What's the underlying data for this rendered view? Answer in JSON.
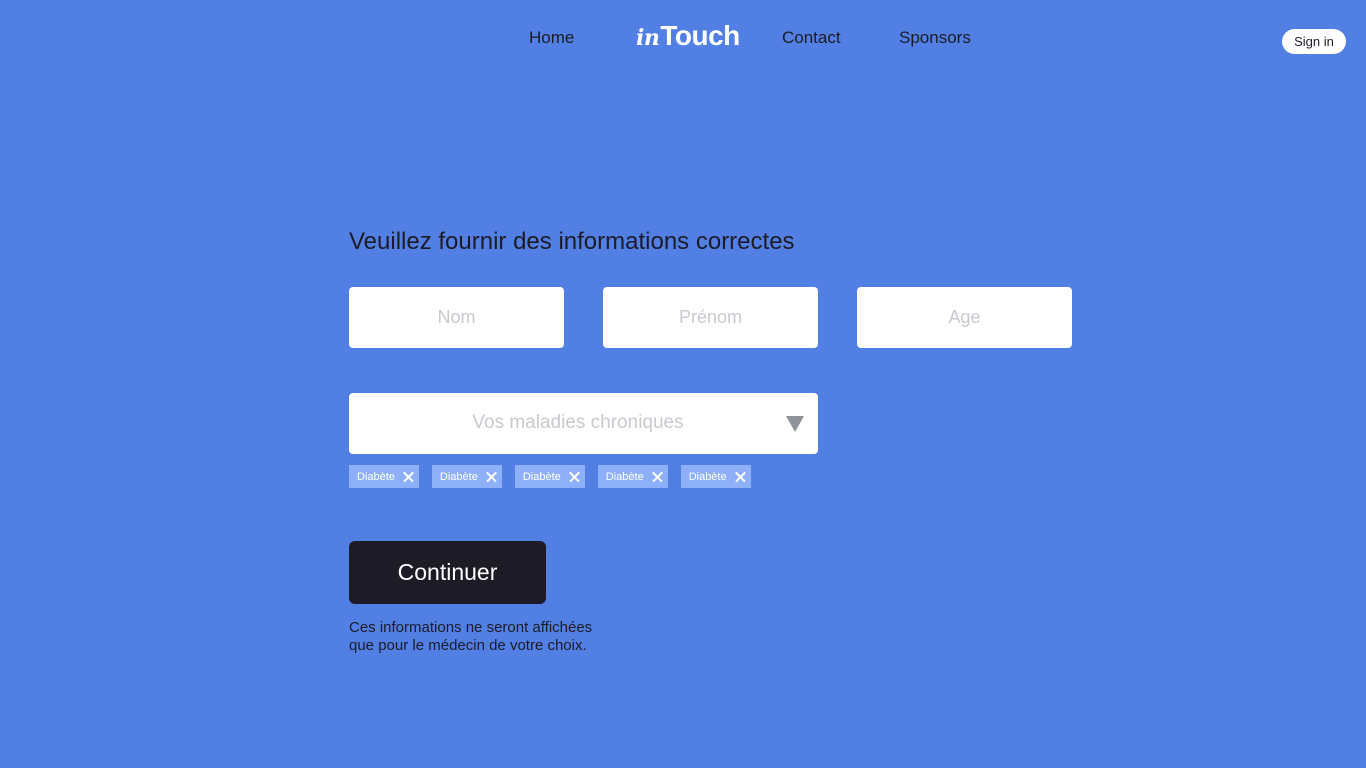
{
  "nav": {
    "home": "Home",
    "logo_prefix": "in",
    "logo_main": "Touch",
    "contact": "Contact",
    "sponsors": "Sponsors",
    "signin": "Sign in"
  },
  "form": {
    "title": "Veuillez fournir des informations correctes",
    "fields": {
      "nom_placeholder": "Nom",
      "prenom_placeholder": "Prénom",
      "age_placeholder": "Age"
    },
    "select": {
      "placeholder": "Vos maladies chroniques",
      "icon": "dropdown-arrow-icon"
    },
    "tags": [
      "Diabète",
      "Diabète",
      "Diabète",
      "Diabète",
      "Diabète"
    ],
    "tag_close_icon": "close-icon",
    "continue_label": "Continuer",
    "note_line1": "Ces informations ne seront affichées",
    "note_line2": "que pour le médecin de votre choix."
  },
  "colors": {
    "background": "#517fe4",
    "button": "#1d1b26",
    "tag": "#8eb0f8",
    "text": "#1d1b26"
  }
}
